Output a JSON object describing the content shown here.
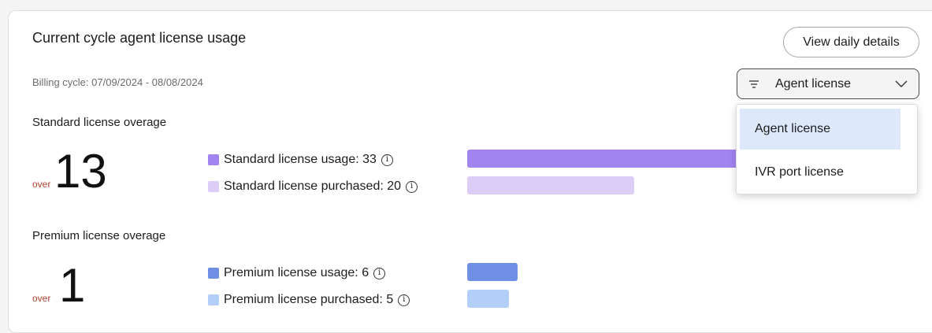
{
  "card": {
    "title": "Current cycle agent license usage",
    "billing_cycle": "Billing cycle: 07/09/2024 - 08/08/2024",
    "view_button": "View daily details"
  },
  "filter": {
    "selected": "Agent license",
    "icon": "filter-icon",
    "options": [
      "Agent license",
      "IVR port license"
    ],
    "selected_index": 0
  },
  "standard": {
    "heading": "Standard license overage",
    "over_label": "over",
    "overage": "13",
    "usage_label": "Standard license usage: 33",
    "purchased_label": "Standard license purchased: 20",
    "usage_value": 33,
    "purchased_value": 20,
    "usage_color": "#a184f0",
    "purchased_color": "#dccdf7"
  },
  "premium": {
    "heading": "Premium license overage",
    "over_label": "over",
    "overage": "1",
    "usage_label": "Premium license usage: 6",
    "purchased_label": "Premium license purchased: 5",
    "usage_value": 6,
    "purchased_value": 5,
    "usage_color": "#6e8fe3",
    "purchased_color": "#b3cef9"
  },
  "info_icon_glyph": "i"
}
